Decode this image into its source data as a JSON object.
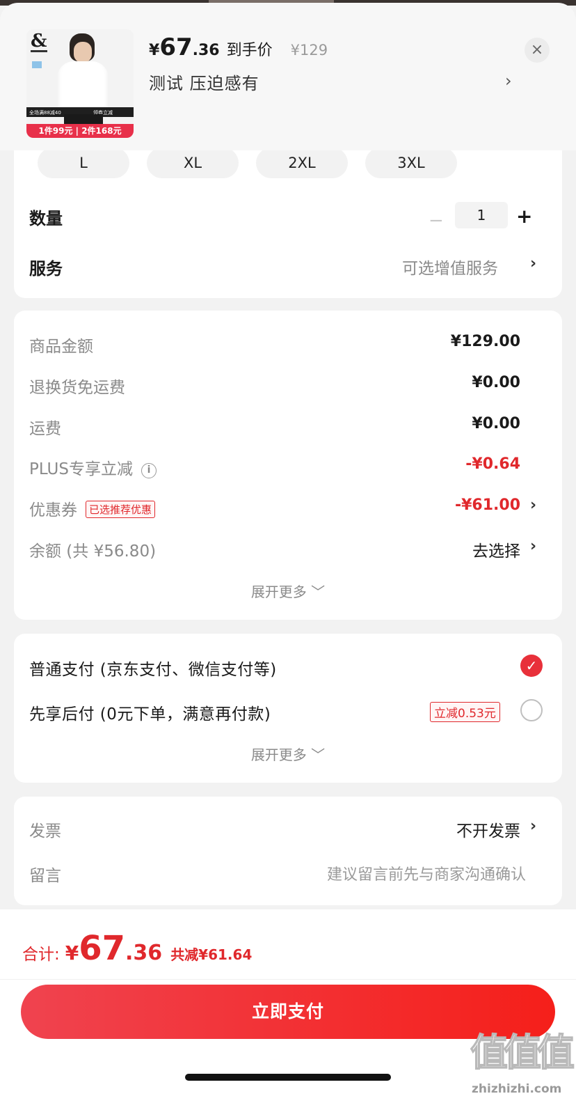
{
  "header": {
    "price_yen": "¥",
    "price_int": "67",
    "price_dec": ".36",
    "price_label": "到手价",
    "original_price": "¥129",
    "spec": "测试 压迫感有",
    "spec_chevron": "›",
    "close_label": "×",
    "thumb": {
      "logo": "&",
      "promo_top": "全场满88减40",
      "promo_top2": "领券立减",
      "promo": "1件99元 | 2件168元"
    }
  },
  "sizes": [
    "L",
    "XL",
    "2XL",
    "3XL"
  ],
  "quantity": {
    "label": "数量",
    "minus": "−",
    "value": "1",
    "plus": "+"
  },
  "service": {
    "label": "服务",
    "value": "可选增值服务",
    "chevron": "›"
  },
  "amounts": {
    "rows": [
      {
        "label": "商品金额",
        "value": "¥129.00"
      },
      {
        "label": "退换货免运费",
        "value": "¥0.00"
      },
      {
        "label": "运费",
        "value": "¥0.00"
      },
      {
        "label": "PLUS专享立减",
        "value": "-¥0.64",
        "info_icon": "i"
      },
      {
        "label": "优惠券",
        "tag": "已选推荐优惠",
        "value": "-¥61.00",
        "chevron": "›"
      },
      {
        "label": "余额 (共 ¥56.80)",
        "value": "去选择",
        "chevron": "›"
      }
    ],
    "expand": "展开更多 ﹀"
  },
  "payment": {
    "options": [
      {
        "label": "普通支付 (京东支付、微信支付等)",
        "selected": true,
        "check": "✓"
      },
      {
        "label": "先享后付 (0元下单，满意再付款)",
        "selected": false,
        "tag": "立减0.53元"
      }
    ],
    "expand": "展开更多 ﹀"
  },
  "extras": {
    "invoice": {
      "label": "发票",
      "value": "不开发票",
      "chevron": "›"
    },
    "memo": {
      "label": "留言",
      "placeholder": "建议留言前先与商家沟通确认"
    }
  },
  "footer": {
    "total_label": "合计:",
    "total_yen": "¥",
    "total_int": "67",
    "total_dec": ".36",
    "saved": "共减¥61.64",
    "pay_button": "立即支付"
  },
  "watermark": {
    "glyphs": "值值值",
    "url": "zhizhizhi.com"
  },
  "colors": {
    "accent_red": "#e0282c",
    "button_start": "#f0434f",
    "button_end": "#f51f1a",
    "background": "#f2f2f2"
  }
}
